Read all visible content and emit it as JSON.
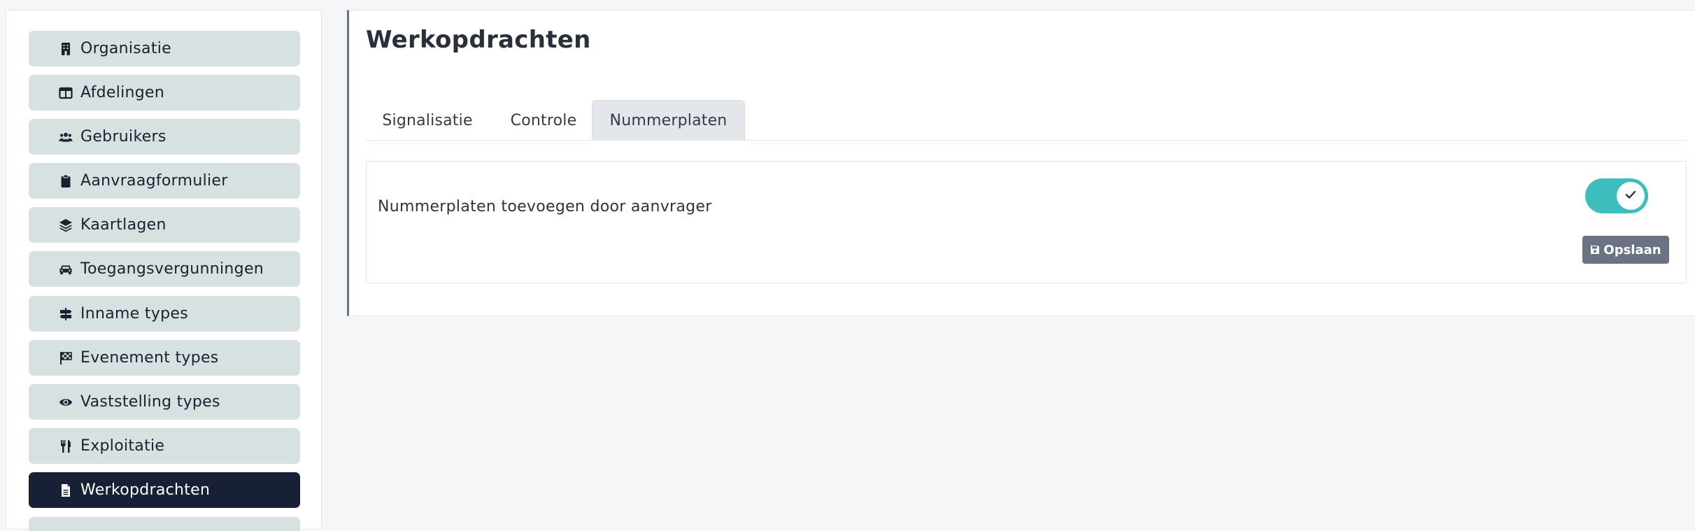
{
  "sidebar": {
    "items": [
      {
        "label": "Organisatie",
        "icon": "building-icon"
      },
      {
        "label": "Afdelingen",
        "icon": "table-columns-icon"
      },
      {
        "label": "Gebruikers",
        "icon": "users-icon"
      },
      {
        "label": "Aanvraagformulier",
        "icon": "clipboard-icon"
      },
      {
        "label": "Kaartlagen",
        "icon": "layers-icon"
      },
      {
        "label": "Toegangsvergunningen",
        "icon": "car-icon"
      },
      {
        "label": "Inname types",
        "icon": "signs-post-icon"
      },
      {
        "label": "Evenement types",
        "icon": "checkered-flag-icon"
      },
      {
        "label": "Vaststelling types",
        "icon": "eye-icon"
      },
      {
        "label": "Exploitatie",
        "icon": "utensils-icon"
      },
      {
        "label": "Werkopdrachten",
        "icon": "file-icon",
        "active": true
      }
    ]
  },
  "main": {
    "title": "Werkopdrachten",
    "tabs": [
      {
        "label": "Signalisatie"
      },
      {
        "label": "Controle"
      },
      {
        "label": "Nummerplaten",
        "active": true
      }
    ],
    "setting": {
      "label": "Nummerplaten toevoegen door aanvrager",
      "enabled": true
    },
    "save_label": "Opslaan"
  },
  "colors": {
    "nav_item_bg": "#d7e1e1",
    "nav_active_bg": "#182036",
    "toggle_on": "#3dbdbe",
    "save_button_bg": "#6b7383"
  }
}
